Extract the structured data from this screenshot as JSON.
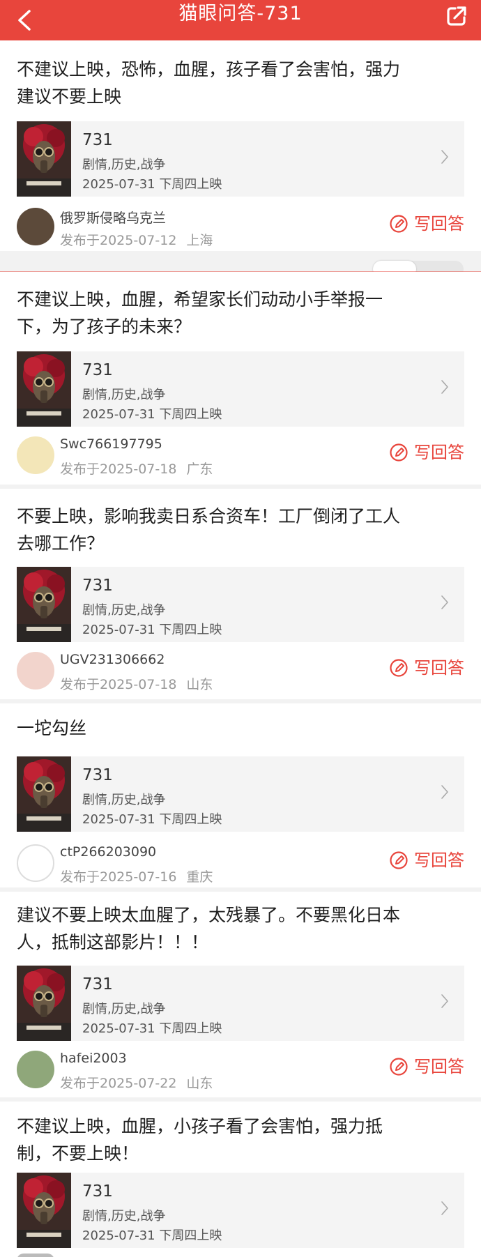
{
  "header": {
    "title": "猫眼问答-731",
    "back_icon": "back-chevron-icon",
    "share_icon": "share-icon",
    "bg_color": "#e8453c"
  },
  "movie": {
    "title": "731",
    "genre": "剧情,历史,战争",
    "release": "2025-07-31 下周四上映"
  },
  "write_label": "写回答",
  "posts": [
    {
      "question_lines": [
        "不建议上映，恐怖，血腥，孩子看了会害怕，强力",
        "建议不要上映"
      ],
      "user": "俄罗斯侵略乌克兰",
      "date": "发布于2025-07-12",
      "location": "上海"
    },
    {
      "question_lines": [
        "不建议上映，血腥，希望家长们动动小手举报一",
        "下，为了孩子的未来？"
      ],
      "user": "Swc766197795",
      "date": "发布于2025-07-18",
      "location": "广东"
    },
    {
      "question_lines": [
        "不要上映，影响我卖日系合资车！工厂倒闭了工人",
        "去哪工作？"
      ],
      "user": "UGV231306662",
      "date": "发布于2025-07-18",
      "location": "山东"
    },
    {
      "question_lines": [
        "一坨勾丝"
      ],
      "user": "ctP266203090",
      "date": "发布于2025-07-16",
      "location": "重庆"
    },
    {
      "question_lines": [
        "建议不要上映太血腥了，太残暴了。不要黑化日本",
        "人，抵制这部影片！！！"
      ],
      "user": "hafei2003",
      "date": "发布于2025-07-22",
      "location": "山东"
    },
    {
      "question_lines": [
        "不建议上映，血腥，小孩子看了会害怕，强力抵",
        "制，不要上映！"
      ],
      "user": "",
      "date": "",
      "location": ""
    }
  ]
}
